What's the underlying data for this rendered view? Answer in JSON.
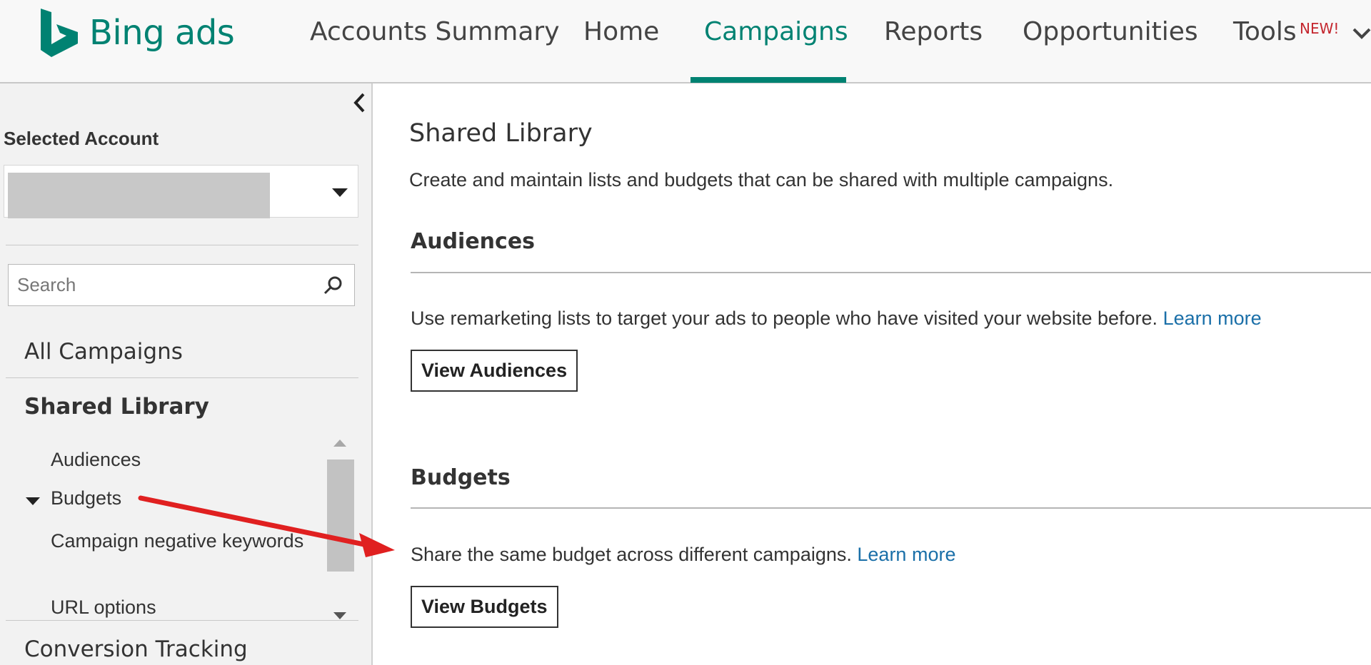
{
  "header": {
    "logo_text": "Bing ads",
    "nav": [
      {
        "label": "Accounts Summary"
      },
      {
        "label": "Home"
      },
      {
        "label": "Campaigns",
        "active": true
      },
      {
        "label": "Reports"
      },
      {
        "label": "Opportunities"
      },
      {
        "label": "Tools"
      }
    ],
    "new_badge": "NEW!"
  },
  "sidebar": {
    "selected_account_label": "Selected Account",
    "search": {
      "placeholder": "Search",
      "value": ""
    },
    "all_campaigns": "All Campaigns",
    "shared_library": "Shared Library",
    "shared_items": [
      "Audiences",
      "Budgets",
      "Campaign negative keywords",
      "URL options"
    ],
    "conversion_tracking": "Conversion Tracking"
  },
  "main": {
    "title": "Shared Library",
    "description": "Create and maintain lists and budgets that can be shared with multiple campaigns.",
    "sections": [
      {
        "title": "Audiences",
        "text": "Use remarketing lists to target your ads to people who have visited your website before.",
        "link": "Learn more",
        "button": "View Audiences"
      },
      {
        "title": "Budgets",
        "text": "Share the same budget across different campaigns.",
        "link": "Learn more",
        "button": "View Budgets"
      }
    ]
  },
  "colors": {
    "brand": "#008272",
    "link": "#1a6fa8",
    "new_badge": "#c4262e",
    "annotation_arrow": "#e02020"
  },
  "icons": [
    "bing-logo-icon",
    "chevron-down-icon",
    "chevron-left-icon",
    "caret-down-icon",
    "search-icon",
    "scroll-up-icon",
    "scroll-down-icon",
    "annotation-arrow-icon"
  ]
}
